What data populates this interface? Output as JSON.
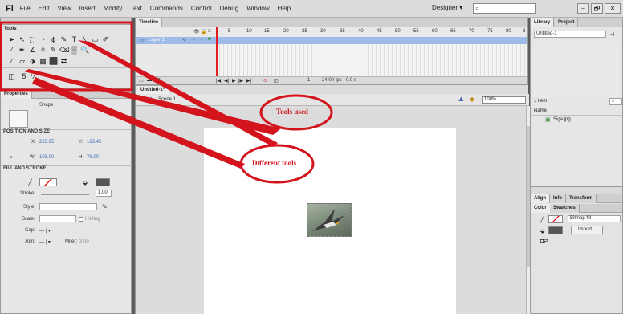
{
  "app": {
    "logo": "Fl",
    "menu": [
      "File",
      "Edit",
      "View",
      "Insert",
      "Modify",
      "Text",
      "Commands",
      "Control",
      "Debug",
      "Window",
      "Help"
    ],
    "workspace": "Designer ▾",
    "window_controls": [
      "–",
      "🗗",
      "✕"
    ]
  },
  "tools_panel": {
    "title": "Tools",
    "rows": [
      [
        "➤",
        "↖",
        "⬚",
        "◔",
        "ϕ",
        "✎",
        "T",
        "╲",
        "▭",
        "✐"
      ],
      [
        "∕",
        "✒",
        "∠",
        "◊",
        "✎",
        "⌫",
        "▒",
        "🔍"
      ],
      [
        "∕",
        "▱",
        "⬗",
        "▦",
        "⬛",
        "⇄"
      ],
      [
        "◫",
        "⁻5",
        "⁺⁄"
      ]
    ]
  },
  "properties": {
    "title": "Properties",
    "type_label": "Shape",
    "position_section": "POSITION AND SIZE",
    "x_label": "X:",
    "x_value": "223.95",
    "y_label": "Y:",
    "y_value": "163.45",
    "w_label": "W:",
    "w_value": "103.00",
    "h_label": "H:",
    "h_value": "79.00",
    "fill_section": "FILL AND STROKE",
    "stroke_label": "Stroke:",
    "stroke_value": "1.00",
    "style_label": "Style:",
    "scale_label": "Scale:",
    "hinting_label": "Hinting",
    "cap_label": "Cap:",
    "cap_value": "— | ▾",
    "join_label": "Join:",
    "join_value": "— | ▾",
    "miter_label": "Miter:",
    "miter_value": "3.00"
  },
  "timeline": {
    "title": "Timeline",
    "frame_numbers": [
      "5",
      "10",
      "15",
      "20",
      "25",
      "30",
      "35",
      "40",
      "45",
      "50",
      "55",
      "60",
      "65",
      "70",
      "75",
      "80",
      "8"
    ],
    "layer_name": "Layer 1",
    "footer_frame": "1",
    "footer_fps": "24.00 fps",
    "footer_time": "0.0 s"
  },
  "stage": {
    "doc_tab": "Untitled-1*",
    "scene": "Scene 1",
    "zoom": "100%"
  },
  "library": {
    "tabs": [
      "Library",
      "Project"
    ],
    "document": "Untitled-1",
    "item_count": "1 item",
    "name_header": "Name",
    "items": [
      "Siga.jpg"
    ]
  },
  "lower_panel": {
    "tabs_top": [
      "Align",
      "Info",
      "Transform"
    ],
    "tabs_bottom": [
      "Color",
      "Swatches"
    ],
    "fill_type": "Bitmap fill",
    "import_label": "Import..."
  },
  "annotations": {
    "tools_used": "Tools used",
    "different_tools": "Different tools"
  },
  "colors": {
    "annotation_red": "#d4141d",
    "layer_highlight": "#9dbbe6",
    "link_blue": "#3b6bb5"
  }
}
